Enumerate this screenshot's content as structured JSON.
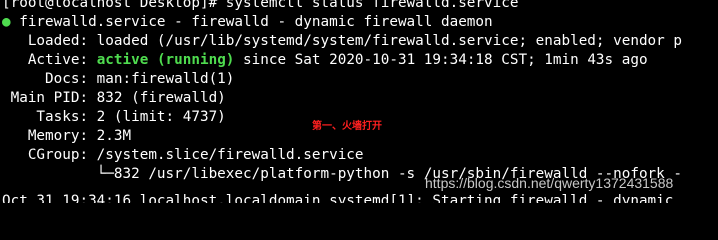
{
  "terminal": {
    "prompt_line": "[root@localhost Desktop]# systemctl status firewalld.service",
    "bullet": "●",
    "unit_line": " firewalld.service - firewalld - dynamic firewall daemon",
    "loaded_line": "   Loaded: loaded (/usr/lib/systemd/system/firewalld.service; enabled; vendor p",
    "active_label": "   Active: ",
    "active_state": "active (running)",
    "active_rest": " since Sat 2020-10-31 19:34:18 CST; 1min 43s ago",
    "docs_line": "     Docs: man:firewalld(1)",
    "mainpid_line": " Main PID: 832 (firewalld)",
    "tasks_line": "    Tasks: 2 (limit: 4737)",
    "memory_line": "   Memory: 2.3M",
    "cgroup_line": "   CGroup: /system.slice/firewalld.service",
    "cgroup_child_line": "           └─832 /usr/libexec/platform-python -s /usr/sbin/firewalld --nofork -",
    "log_line": "Oct 31 19:34:16 localhost.localdomain systemd[1]: Starting firewalld - dynamic"
  },
  "annotation": "第一、火墙打开",
  "watermark": "https://blog.csdn.net/qwerty1372431588",
  "colors": {
    "background": "#000000",
    "text": "#ffffff",
    "active_green": "#4fdc4f",
    "annotation_red": "#ff2020"
  }
}
